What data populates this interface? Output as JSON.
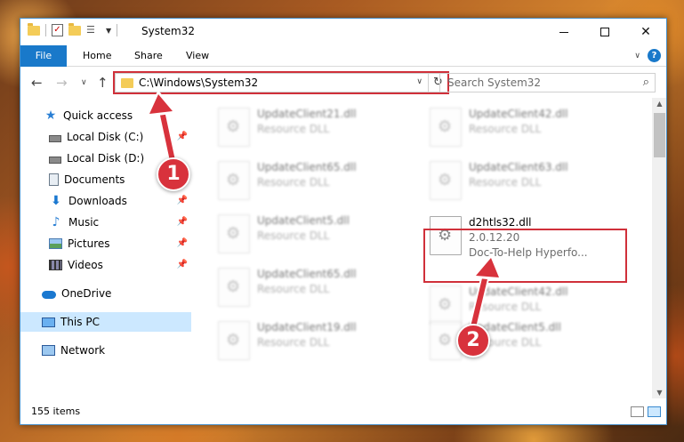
{
  "window": {
    "title": "System32",
    "minimize_label": "Minimize",
    "maximize_label": "Maximize",
    "close_symbol": "✕"
  },
  "ribbon": {
    "tabs": [
      "File",
      "Home",
      "Share",
      "View"
    ],
    "help": "?"
  },
  "address_bar": {
    "path": "C:\\Windows\\System32"
  },
  "search": {
    "placeholder": "Search System32"
  },
  "sidebar": {
    "items": [
      {
        "label": "Quick access",
        "icon": "star-icon"
      },
      {
        "label": "Local Disk (C:)",
        "icon": "disk-icon"
      },
      {
        "label": "Local Disk (D:)",
        "icon": "disk-icon"
      },
      {
        "label": "Documents",
        "icon": "documents-icon"
      },
      {
        "label": "Downloads",
        "icon": "download-icon"
      },
      {
        "label": "Music",
        "icon": "music-icon"
      },
      {
        "label": "Pictures",
        "icon": "pictures-icon"
      },
      {
        "label": "Videos",
        "icon": "videos-icon"
      },
      {
        "label": "OneDrive",
        "icon": "cloud-icon"
      },
      {
        "label": "This PC",
        "icon": "computer-icon"
      },
      {
        "label": "Network",
        "icon": "network-icon"
      }
    ]
  },
  "files": [
    {
      "name": "UpdateClient21.dll",
      "sub": "Resource DLL"
    },
    {
      "name": "UpdateClient42.dll",
      "sub": "Resource DLL"
    },
    {
      "name": "UpdateClient65.dll",
      "sub": "Resource DLL"
    },
    {
      "name": "UpdateClient63.dll",
      "sub": "Resource DLL"
    },
    {
      "name": "UpdateClient5.dll",
      "sub": "Resource DLL"
    },
    {
      "name": "d2htls32.dll",
      "sub": "2.0.12.20",
      "sub2": "Doc-To-Help Hyperfo..."
    },
    {
      "name": "UpdateClient65.dll",
      "sub": "Resource DLL"
    },
    {
      "name": "UpdateClient42.dll",
      "sub": "Resource DLL"
    },
    {
      "name": "UpdateClient19.dll",
      "sub": "Resource DLL"
    },
    {
      "name": "UpdateClient5.dll",
      "sub": "Resource DLL"
    }
  ],
  "status": {
    "item_count": "155 items"
  },
  "callouts": [
    "1",
    "2"
  ],
  "colors": {
    "accent": "#1979ca",
    "highlight": "#d0303a",
    "selected": "#cce8ff"
  }
}
